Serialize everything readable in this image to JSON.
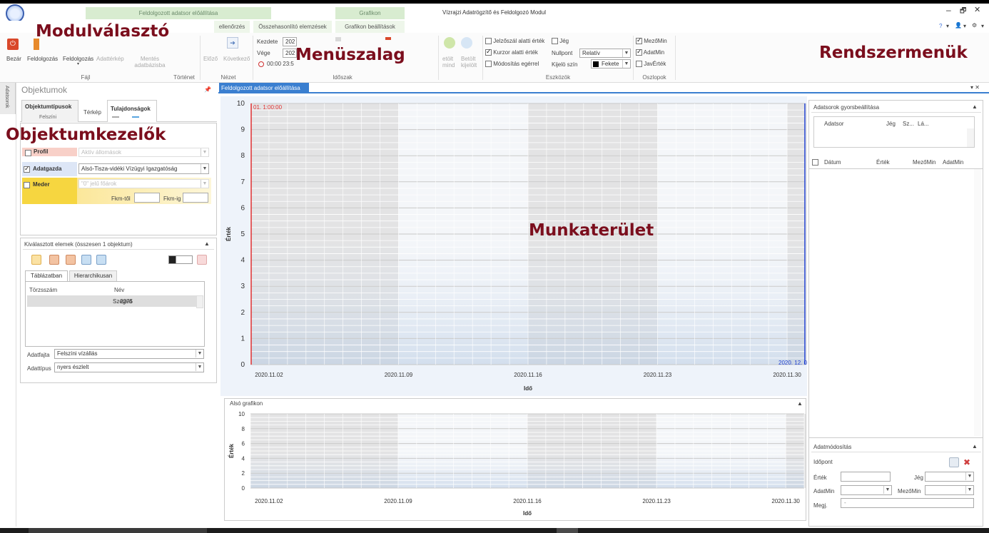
{
  "window": {
    "title": "Vízrajzi Adatrögzítő és Feldolgozó Modul",
    "context_tabs": [
      "Feldolgozott adatsor előállítása",
      "Grafikon"
    ],
    "controls": [
      "–",
      "🗗",
      "✕"
    ],
    "right_icons": [
      "?",
      "▾",
      "👤",
      "▾",
      "⚙",
      "▾"
    ]
  },
  "ribbon": {
    "tabs": [
      "ellenőrzés",
      "Összehasonlító elemzések",
      "Grafikon beállítások"
    ],
    "file": {
      "buttons": [
        "Bezár",
        "Feldolgozás",
        "Feldolgozás",
        "Adattérkép",
        "Mentés adatbázisba"
      ],
      "group_label": "Fájl"
    },
    "history_label": "Történet",
    "view": {
      "prev": "Előző",
      "next": "Következő",
      "group_label": "Nézet"
    },
    "period": {
      "start_label": "Kezdete",
      "start_value": "202",
      "end_label": "Vége",
      "end_value": "202",
      "time": "00:00 23:5",
      "group_label": "Időszak"
    },
    "tools_buttons": [
      "etölt mind",
      "Betölt kijelölt"
    ],
    "tools": {
      "below_hair": "Jelzőszál alatti érték",
      "ice": "Jég",
      "cursor_below": "Kurzor alatti érték",
      "zero_point_label": "Nullpont",
      "zero_point_value": "Relatív",
      "mouse_edit": "Módosítás egérrel",
      "select_color_label": "Kijelö szín",
      "select_color_value": "Fekete",
      "group_label": "Eszközök"
    },
    "columns": {
      "items": [
        {
          "label": "MezőMin",
          "checked": true
        },
        {
          "label": "AdatMin",
          "checked": true
        },
        {
          "label": "JavÉrték",
          "checked": false
        }
      ],
      "group_label": "Oszlopok"
    }
  },
  "overlays": {
    "module_selector": "Modulválasztó",
    "ribbon": "Menüszalag",
    "system_menus": "Rendszermenük",
    "object_handlers": "Objektumkezelők",
    "workspace": "Munkaterület"
  },
  "left_panel": {
    "side_tab": "Adatsorok",
    "title": "Objektumok",
    "tabs": [
      "Objektumtípusok",
      "Térkép",
      "Tulajdonságok"
    ],
    "tab_sub": "Felszíni",
    "filters": [
      {
        "label": "Profil",
        "value": "Aktív állomások",
        "checked": false,
        "enabled": false
      },
      {
        "label": "Adatgazda",
        "value": "Alsó-Tisza-vidéki Vízügyi Igazgatóság",
        "checked": true,
        "enabled": true
      },
      {
        "label": "Meder",
        "value": "\"0\" jelű főárok",
        "checked": false,
        "enabled": false
      }
    ],
    "fkm_from": "Fkm-től",
    "fkm_to": "Fkm-ig",
    "selected": {
      "title": "Kiválasztott elemek (összesen 1 objektum)",
      "tabs": [
        "Táblázatban",
        "Hierarchikusan"
      ],
      "columns": [
        "Törzsszám",
        "Név"
      ],
      "rows": [
        {
          "id": "2275",
          "name": "Szeged"
        }
      ],
      "datatype_label": "Adatfajta",
      "datatype_value": "Felszíni vízállás",
      "kind_label": "Adattípus",
      "kind_value": "nyers észlelt"
    }
  },
  "doc_tab": "Feldolgozott adatsor előállítása",
  "main_chart": {
    "cursor_label": "01. 1:00:00",
    "end_label": "2020. 12. 0"
  },
  "lower_chart": {
    "title": "Alsó grafikon"
  },
  "right_panel": {
    "quick_title": "Adatsorok gyorsbeállítása",
    "quick_columns": [
      "Adatsor",
      "Jég",
      "Sz...",
      "Lá..."
    ],
    "data_columns": [
      "Dátum",
      "Érték",
      "MezőMin",
      "AdatMin"
    ],
    "edit_title": "Adatmódosítás",
    "time_label": "Időpont",
    "value_label": "Érték",
    "ice_label": "Jég",
    "datamin_label": "AdatMin",
    "fieldmin_label": "MezőMin",
    "note_label": "Megj.",
    "note_value": "-"
  },
  "chart_data": [
    {
      "type": "line",
      "title": "",
      "xlabel": "Idő",
      "ylabel": "Érték",
      "x_ticks": [
        "2020.11.02",
        "2020.11.09",
        "2020.11.16",
        "2020.11.23",
        "2020.11.30"
      ],
      "ylim": [
        0,
        10
      ],
      "y_ticks": [
        0,
        1,
        2,
        3,
        4,
        5,
        6,
        7,
        8,
        9,
        10
      ],
      "series": [],
      "grid": true
    },
    {
      "type": "line",
      "title": "Alsó grafikon",
      "xlabel": "Idő",
      "ylabel": "Érték",
      "x_ticks": [
        "2020.11.02",
        "2020.11.09",
        "2020.11.16",
        "2020.11.23",
        "2020.11.30"
      ],
      "ylim": [
        0,
        10
      ],
      "y_ticks": [
        0,
        2,
        4,
        6,
        8,
        10
      ],
      "series": [],
      "grid": true
    }
  ]
}
